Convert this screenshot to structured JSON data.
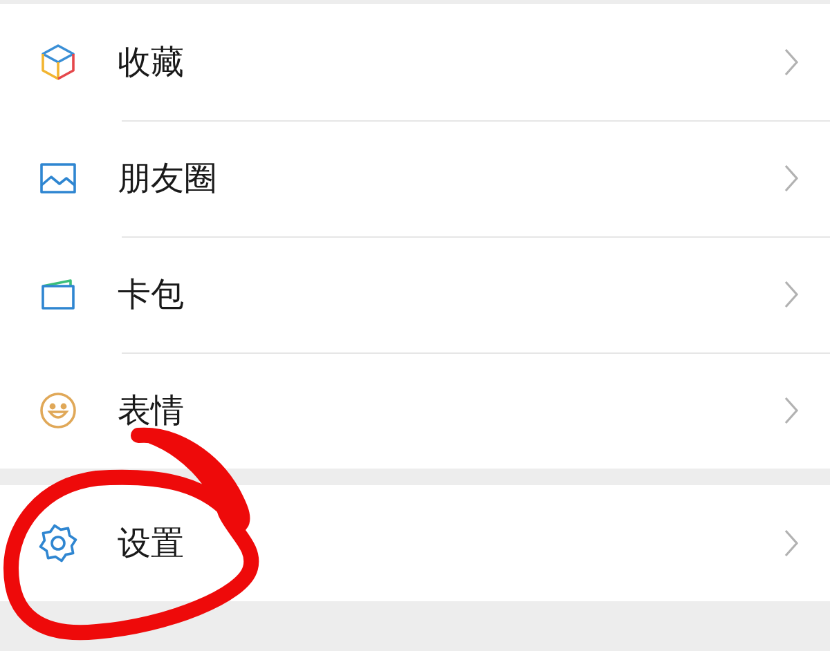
{
  "groups": [
    {
      "items": [
        {
          "kind": "favorites",
          "label": "收藏",
          "circled": false
        },
        {
          "kind": "moments",
          "label": "朋友圈",
          "circled": false
        },
        {
          "kind": "cards",
          "label": "卡包",
          "circled": false
        },
        {
          "kind": "stickers",
          "label": "表情",
          "circled": false
        }
      ]
    },
    {
      "items": [
        {
          "kind": "settings",
          "label": "设置",
          "circled": true
        }
      ]
    }
  ]
}
